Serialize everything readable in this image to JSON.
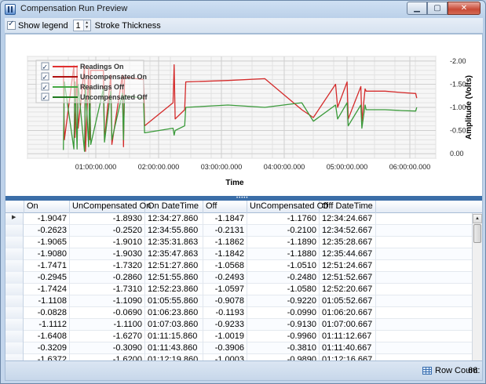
{
  "window": {
    "title": "Compensation Run Preview",
    "minimize_glyph": "▁",
    "maximize_glyph": "▢",
    "close_glyph": "✕"
  },
  "toolbar": {
    "show_legend_label": "Show legend",
    "show_legend_checked": true,
    "stroke_thickness_value": "1",
    "stroke_thickness_label": "Stroke Thickness"
  },
  "chart_data": {
    "type": "line",
    "xlabel": "Time",
    "ylabel": "Amplitude (Volts)",
    "x_ticks": [
      "01:00:00.000",
      "02:00:00.000",
      "03:00:00.000",
      "04:00:00.000",
      "05:00:00.000",
      "06:00:00.000"
    ],
    "y_ticks": [
      "-2.00",
      "-1.50",
      "-1.00",
      "-0.50",
      "0.00"
    ],
    "ylim": [
      0.1,
      -2.1
    ],
    "xlim": [
      0,
      387
    ],
    "grid": true,
    "legend_position": "top-left",
    "legend": [
      {
        "name": "Readings On",
        "checked": true,
        "color": "#e03030"
      },
      {
        "name": "Uncompensated On",
        "checked": true,
        "color": "#b01010"
      },
      {
        "name": "Readings Off",
        "checked": true,
        "color": "#44a844"
      },
      {
        "name": "Uncompensated Off",
        "checked": true,
        "color": "#1f7a1f"
      }
    ],
    "series": [
      {
        "name": "Readings On",
        "color": "#d42a2a",
        "x": [
          34,
          35,
          44,
          45,
          47,
          48,
          54,
          55,
          58,
          59,
          60,
          72,
          73,
          79,
          80,
          90,
          91,
          92,
          110,
          111,
          138,
          139,
          140,
          149,
          150,
          190,
          225,
          260,
          271,
          292,
          294,
          303,
          304,
          316,
          317,
          320,
          321,
          339,
          355,
          368,
          369
        ],
        "y": [
          -1.9,
          -0.3,
          -1.9,
          -0.35,
          -1.9,
          -0.55,
          -1.9,
          -0.05,
          -1.85,
          -0.3,
          -1.8,
          -1.8,
          -0.3,
          -1.7,
          -0.2,
          -1.7,
          -0.15,
          -1.65,
          -1.6,
          -0.6,
          -1.1,
          -1.92,
          -0.75,
          -0.95,
          -1.55,
          -1.58,
          -1.62,
          -0.95,
          -0.78,
          -1.5,
          -1.0,
          -1.55,
          -0.75,
          -1.45,
          -0.7,
          -1.4,
          -1.35,
          -1.35,
          -1.32,
          -1.3,
          -1.2
        ]
      },
      {
        "name": "Readings Off",
        "color": "#3a9a3a",
        "x": [
          34,
          35,
          44,
          45,
          47,
          48,
          54,
          55,
          58,
          59,
          60,
          72,
          73,
          79,
          80,
          90,
          91,
          92,
          110,
          111,
          138,
          139,
          140,
          149,
          150,
          190,
          225,
          260,
          271,
          292,
          294,
          303,
          304,
          316,
          317,
          320,
          321,
          339,
          355,
          368,
          369
        ],
        "y": [
          -0.08,
          -1.55,
          -0.1,
          -1.55,
          -0.1,
          -1.5,
          -0.05,
          -1.5,
          -0.15,
          -1.45,
          -0.2,
          -1.4,
          -0.25,
          -1.35,
          -0.3,
          -1.3,
          -0.3,
          -1.25,
          -1.2,
          -0.45,
          -0.55,
          -0.4,
          -0.5,
          -0.6,
          -1.0,
          -1.05,
          -1.0,
          -1.1,
          -0.7,
          -1.05,
          -0.75,
          -1.1,
          -0.6,
          -1.05,
          -0.55,
          -1.05,
          -0.95,
          -0.95,
          -0.93,
          -0.92,
          -1.0
        ]
      }
    ]
  },
  "table": {
    "columns": [
      "On",
      "UnCompensated On",
      "On DateTime",
      "Off",
      "UnCompensated Off",
      "Off DateTime"
    ],
    "rows": [
      [
        "-1.9047",
        "-1.8930",
        "12:34:27.860",
        "-1.1847",
        "-1.1760",
        "12:34:24.667"
      ],
      [
        "-0.2623",
        "-0.2520",
        "12:34:55.860",
        "-0.2131",
        "-0.2100",
        "12:34:52.667"
      ],
      [
        "-1.9065",
        "-1.9010",
        "12:35:31.863",
        "-1.1862",
        "-1.1890",
        "12:35:28.667"
      ],
      [
        "-1.9080",
        "-1.9030",
        "12:35:47.863",
        "-1.1842",
        "-1.1880",
        "12:35:44.667"
      ],
      [
        "-1.7471",
        "-1.7320",
        "12:51:27.860",
        "-1.0568",
        "-1.0510",
        "12:51:24.667"
      ],
      [
        "-0.2945",
        "-0.2860",
        "12:51:55.860",
        "-0.2493",
        "-0.2480",
        "12:51:52.667"
      ],
      [
        "-1.7424",
        "-1.7310",
        "12:52:23.860",
        "-1.0597",
        "-1.0580",
        "12:52:20.667"
      ],
      [
        "-1.1108",
        "-1.1090",
        "01:05:55.860",
        "-0.9078",
        "-0.9220",
        "01:05:52.667"
      ],
      [
        "-0.0828",
        "-0.0690",
        "01:06:23.860",
        "-0.1193",
        "-0.0990",
        "01:06:20.667"
      ],
      [
        "-1.1112",
        "-1.1100",
        "01:07:03.860",
        "-0.9233",
        "-0.9130",
        "01:07:00.667"
      ],
      [
        "-1.6408",
        "-1.6270",
        "01:11:15.860",
        "-1.0019",
        "-0.9960",
        "01:11:12.667"
      ],
      [
        "-0.3209",
        "-0.3090",
        "01:11:43.860",
        "-0.3906",
        "-0.3810",
        "01:11:40.667"
      ],
      [
        "-1.6372",
        "-1.6200",
        "01:12:19.860",
        "-1.0003",
        "-0.9890",
        "01:12:16.667"
      ]
    ]
  },
  "status": {
    "row_count_label": "Row Count:",
    "row_count_value": "66"
  }
}
